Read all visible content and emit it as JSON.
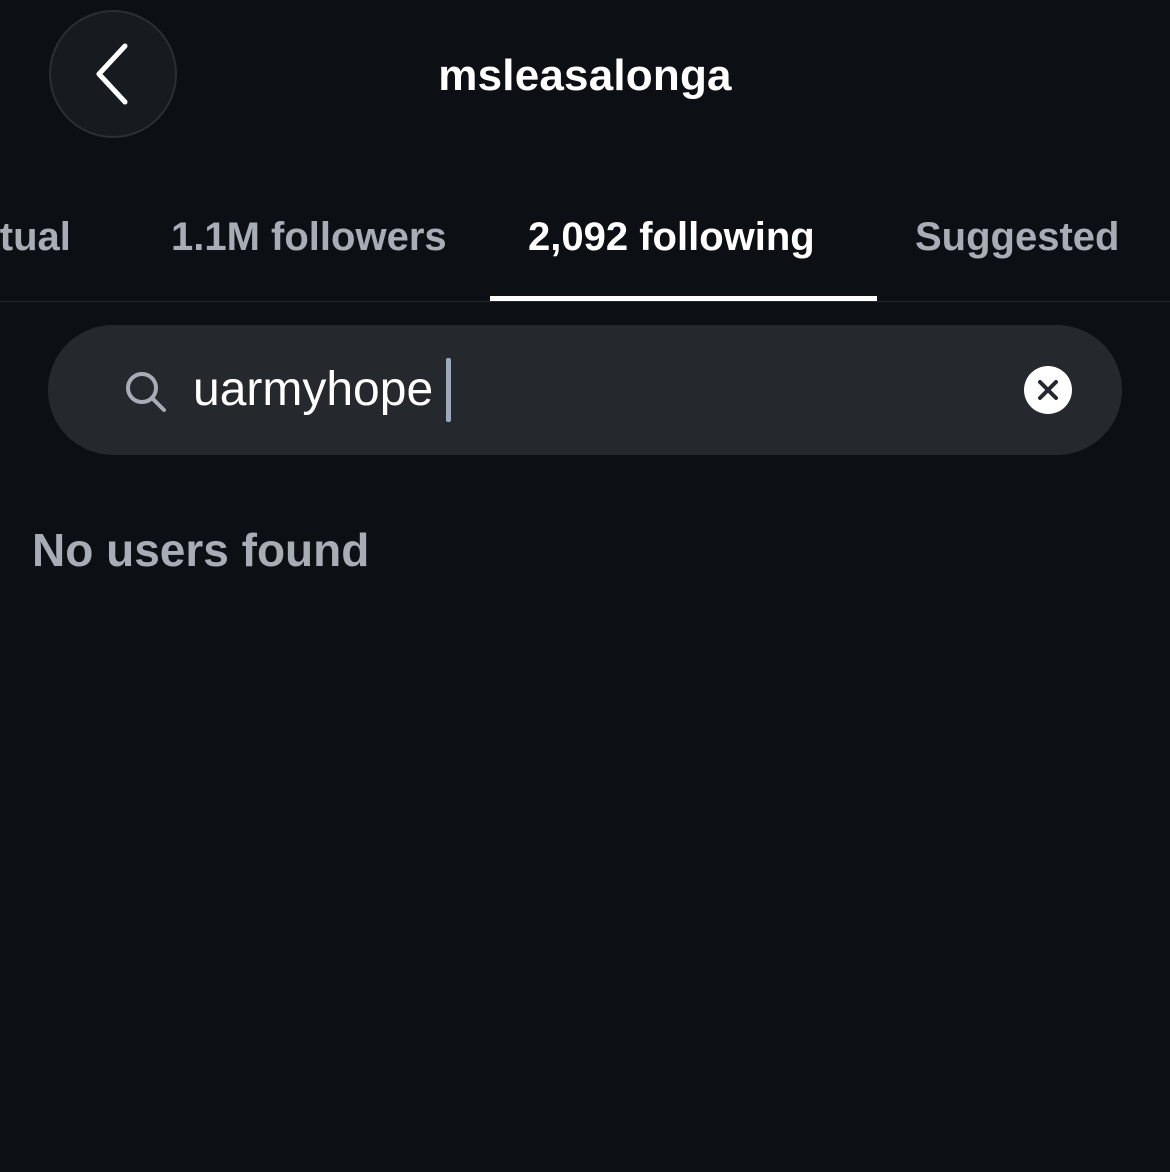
{
  "header": {
    "title": "msleasalonga",
    "back_icon": "chevron-left-icon"
  },
  "tabs": [
    {
      "label": "Mutual",
      "active": false
    },
    {
      "label": "1.1M followers",
      "active": false
    },
    {
      "label": "2,092 following",
      "active": true
    },
    {
      "label": "Suggested",
      "active": false
    }
  ],
  "search": {
    "value": "uarmyhope",
    "icon": "search-icon",
    "clear_icon": "clear-icon"
  },
  "results": {
    "empty_message": "No users found"
  },
  "colors": {
    "background": "#0c1014",
    "search_bg": "#25292e",
    "muted_text": "#a8adb5",
    "active_text": "#ffffff"
  }
}
